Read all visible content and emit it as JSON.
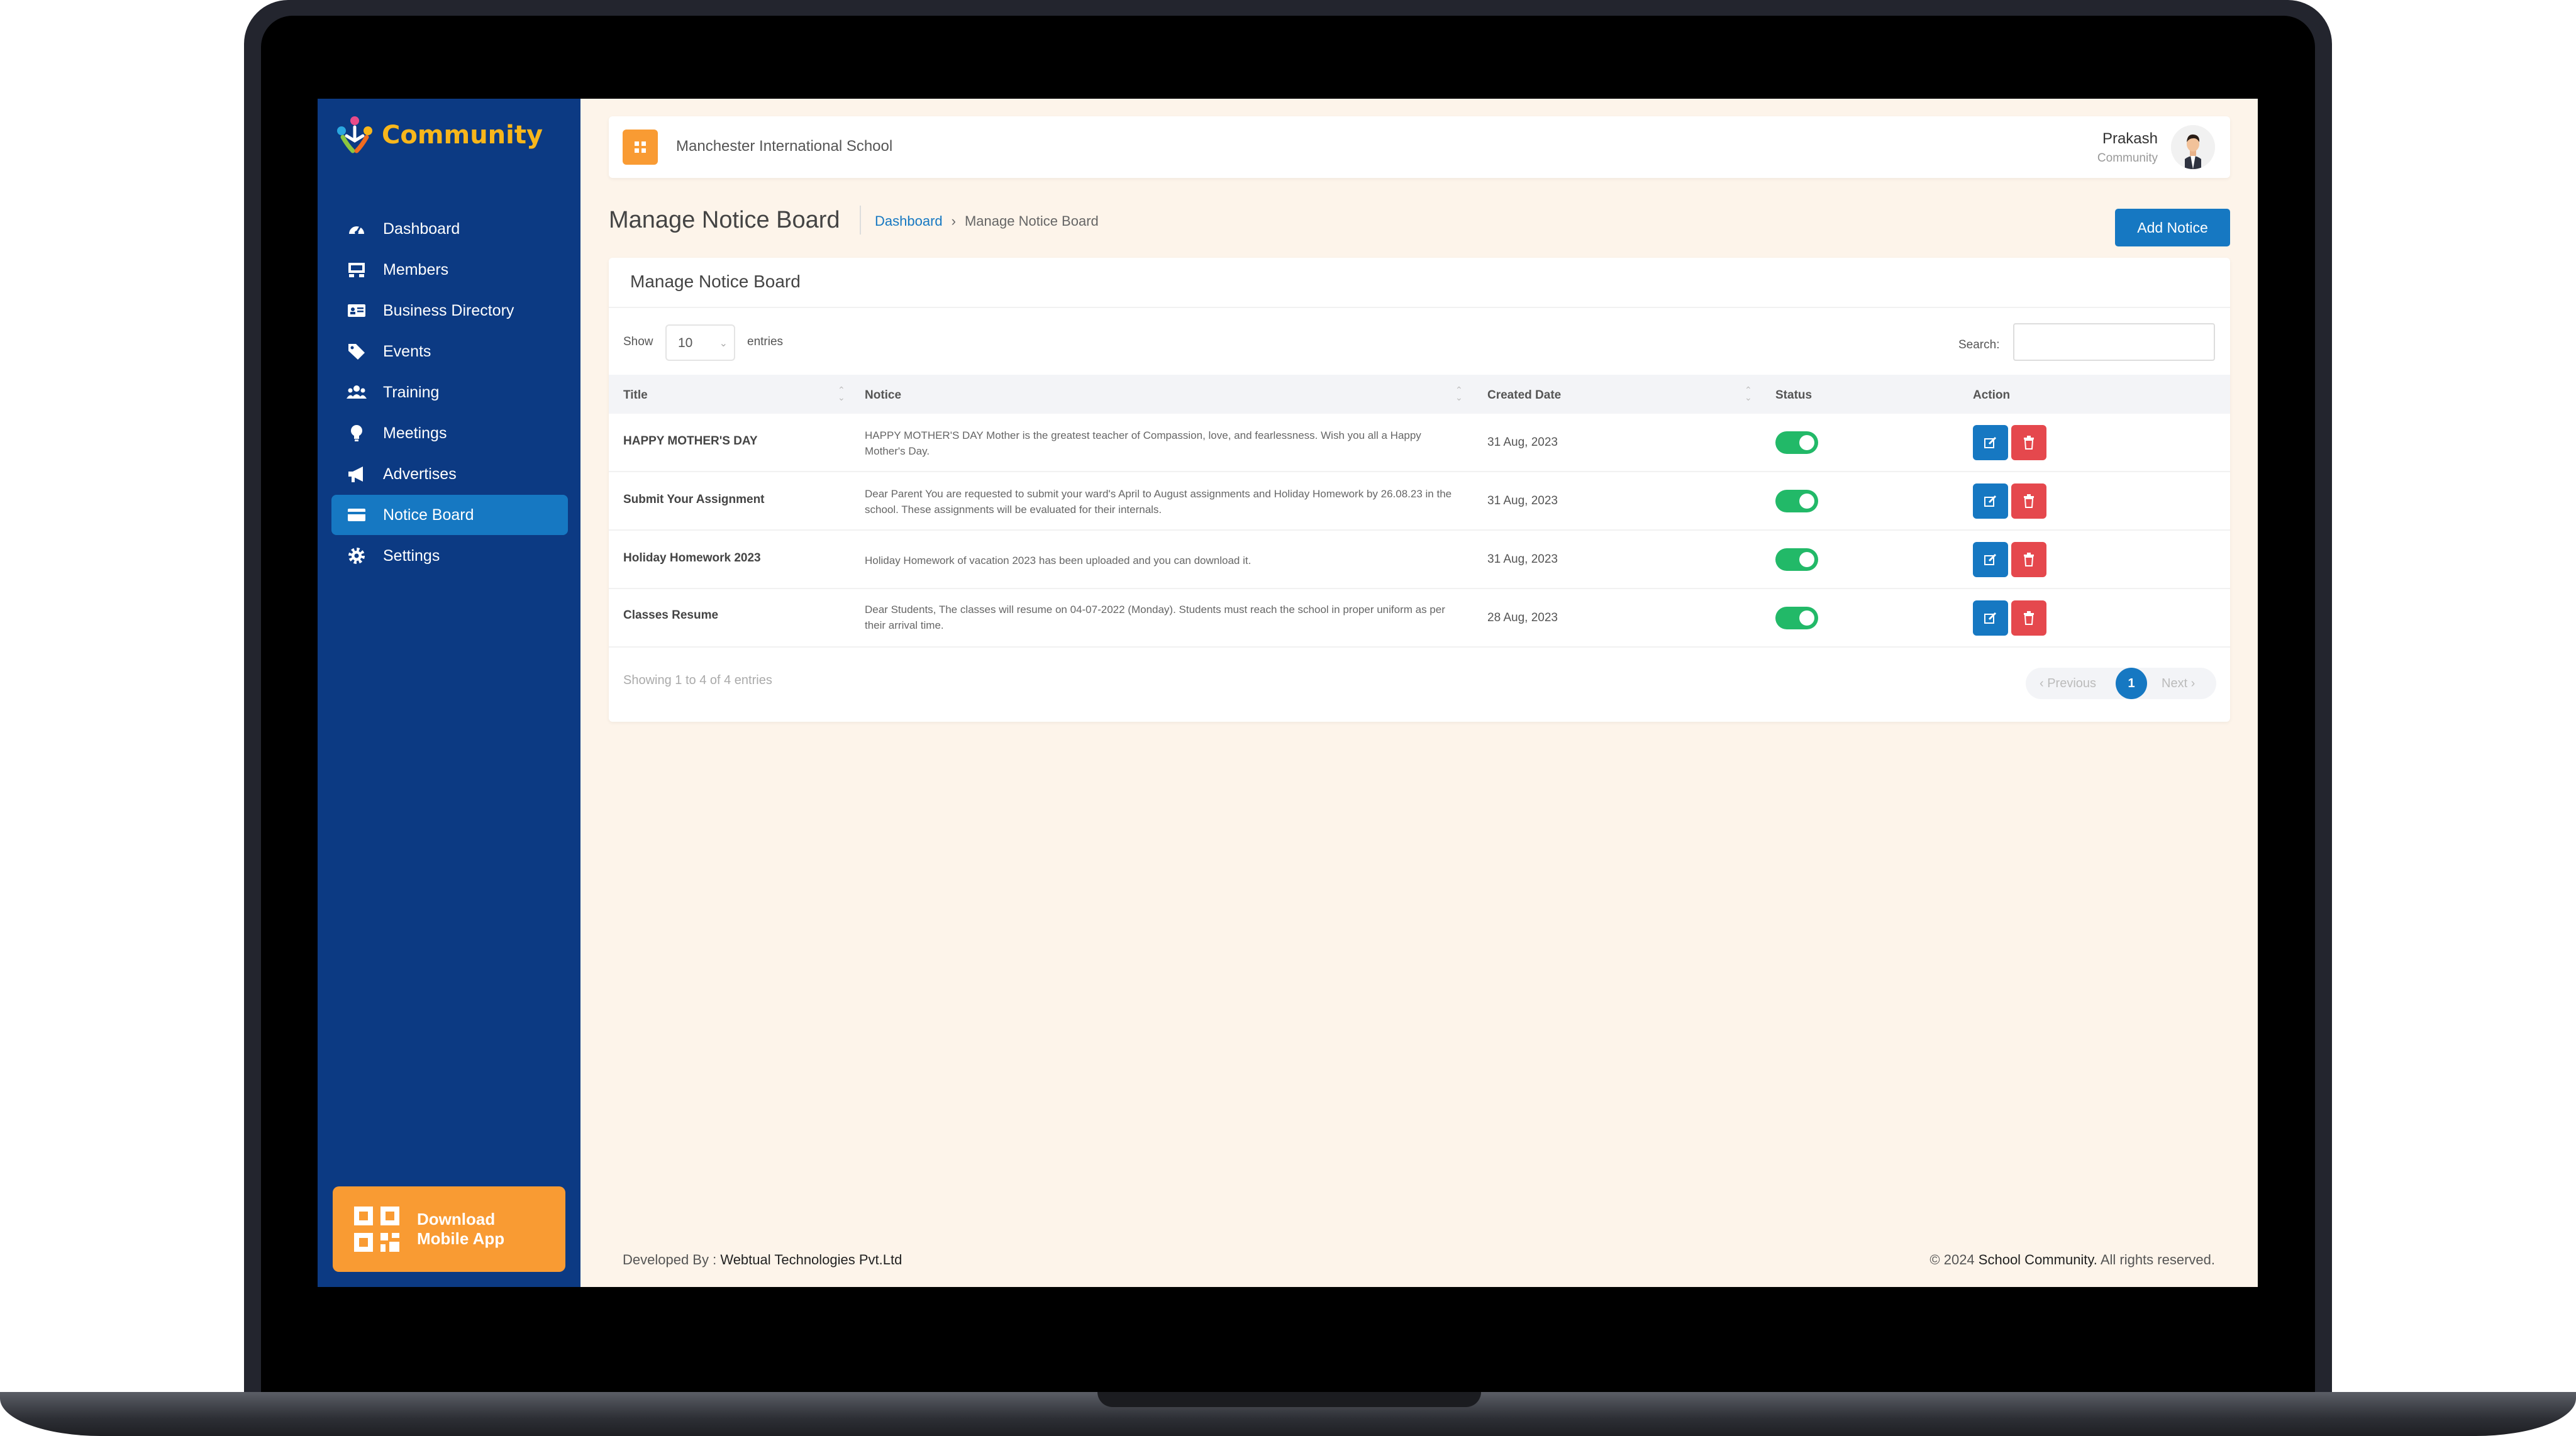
{
  "brand": {
    "name": "Community"
  },
  "sidebar": {
    "items": [
      {
        "label": "Dashboard",
        "icon": "dashboard-icon"
      },
      {
        "label": "Members",
        "icon": "members-icon"
      },
      {
        "label": "Business Directory",
        "icon": "business-card-icon"
      },
      {
        "label": "Events",
        "icon": "tag-icon"
      },
      {
        "label": "Training",
        "icon": "users-icon"
      },
      {
        "label": "Meetings",
        "icon": "lightbulb-icon"
      },
      {
        "label": "Advertises",
        "icon": "megaphone-icon"
      },
      {
        "label": "Notice Board",
        "icon": "notice-icon",
        "active": true
      },
      {
        "label": "Settings",
        "icon": "gear-icon"
      }
    ],
    "download": {
      "line1": "Download",
      "line2": "Mobile App"
    }
  },
  "header": {
    "school": "Manchester International School",
    "user_name": "Prakash",
    "user_role": "Community"
  },
  "page": {
    "title": "Manage Notice Board",
    "breadcrumb": {
      "home": "Dashboard",
      "separator": "›",
      "current": "Manage Notice Board"
    },
    "add_button": "Add Notice"
  },
  "card": {
    "title": "Manage Notice Board",
    "show_label": "Show",
    "page_length": "10",
    "entries_label": "entries",
    "search_label": "Search:",
    "columns": [
      "Title",
      "Notice",
      "Created Date",
      "Status",
      "Action"
    ],
    "rows": [
      {
        "title": "HAPPY MOTHER'S DAY",
        "notice": "HAPPY MOTHER'S DAY Mother is the greatest teacher of Compassion, love, and fearlessness. Wish you all a Happy Mother's Day.",
        "date": "31 Aug, 2023",
        "status": true
      },
      {
        "title": "Submit Your Assignment",
        "notice": "Dear Parent You are requested to submit your ward's April to August assignments and Holiday Homework by 26.08.23 in the school. These assignments will be evaluated for their internals.",
        "date": "31 Aug, 2023",
        "status": true
      },
      {
        "title": "Holiday Homework 2023",
        "notice": "Holiday Homework of vacation 2023 has been uploaded and you can download it.",
        "date": "31 Aug, 2023",
        "status": true
      },
      {
        "title": "Classes Resume",
        "notice": "Dear Students, The classes will resume on 04-07-2022 (Monday). Students must reach the school in proper uniform as per their arrival time.",
        "date": "28 Aug, 2023",
        "status": true
      }
    ],
    "info": "Showing 1 to 4 of 4 entries",
    "pager": {
      "prev": "‹ Previous",
      "current": "1",
      "next": "Next ›"
    }
  },
  "footer": {
    "dev_prefix": "Developed By :",
    "dev_company": "Webtual Technologies Pvt.Ltd",
    "copy_prefix": "© 2024",
    "copy_name": "School Community.",
    "copy_suffix": "All rights reserved."
  },
  "colors": {
    "sidebar_bg": "#0c3a83",
    "accent_blue": "#1678c2",
    "accent_orange": "#f99b33",
    "brand_yellow": "#f8b61b",
    "status_green": "#22b968",
    "danger_red": "#e5484d",
    "content_bg": "#fdf4ea"
  }
}
